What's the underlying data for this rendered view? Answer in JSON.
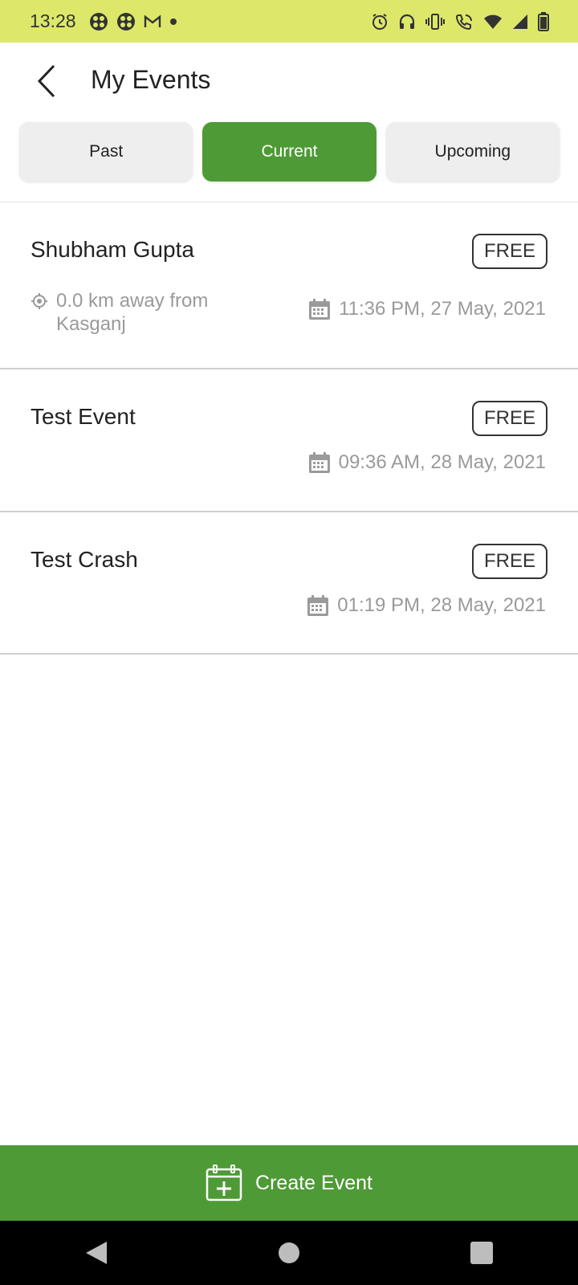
{
  "status_bar": {
    "time": "13:28",
    "left_icons": [
      "app-icon-1",
      "app-icon-2",
      "gmail-icon",
      "dot-icon"
    ],
    "right_icons": [
      "alarm-icon",
      "headset-icon",
      "vibrate-icon",
      "wifi-calling-icon",
      "wifi-icon",
      "signal-icon",
      "battery-icon"
    ],
    "background": "#dde86a"
  },
  "header": {
    "title": "My Events"
  },
  "tabs": [
    {
      "label": "Past",
      "active": false
    },
    {
      "label": "Current",
      "active": true
    },
    {
      "label": "Upcoming",
      "active": false
    }
  ],
  "events": [
    {
      "name": "Shubham Gupta",
      "price": "FREE",
      "location": "0.0 km away from Kasganj",
      "datetime": "11:36 PM, 27 May, 2021"
    },
    {
      "name": "Test Event",
      "price": "FREE",
      "location": "",
      "datetime": "09:36 AM, 28 May, 2021"
    },
    {
      "name": "Test Crash",
      "price": "FREE",
      "location": "",
      "datetime": "01:19 PM, 28 May, 2021"
    }
  ],
  "create_button": {
    "label": "Create Event"
  },
  "colors": {
    "accent": "#4e9a36",
    "tab_inactive": "#eeeeee",
    "muted_text": "#9a9a9a"
  }
}
